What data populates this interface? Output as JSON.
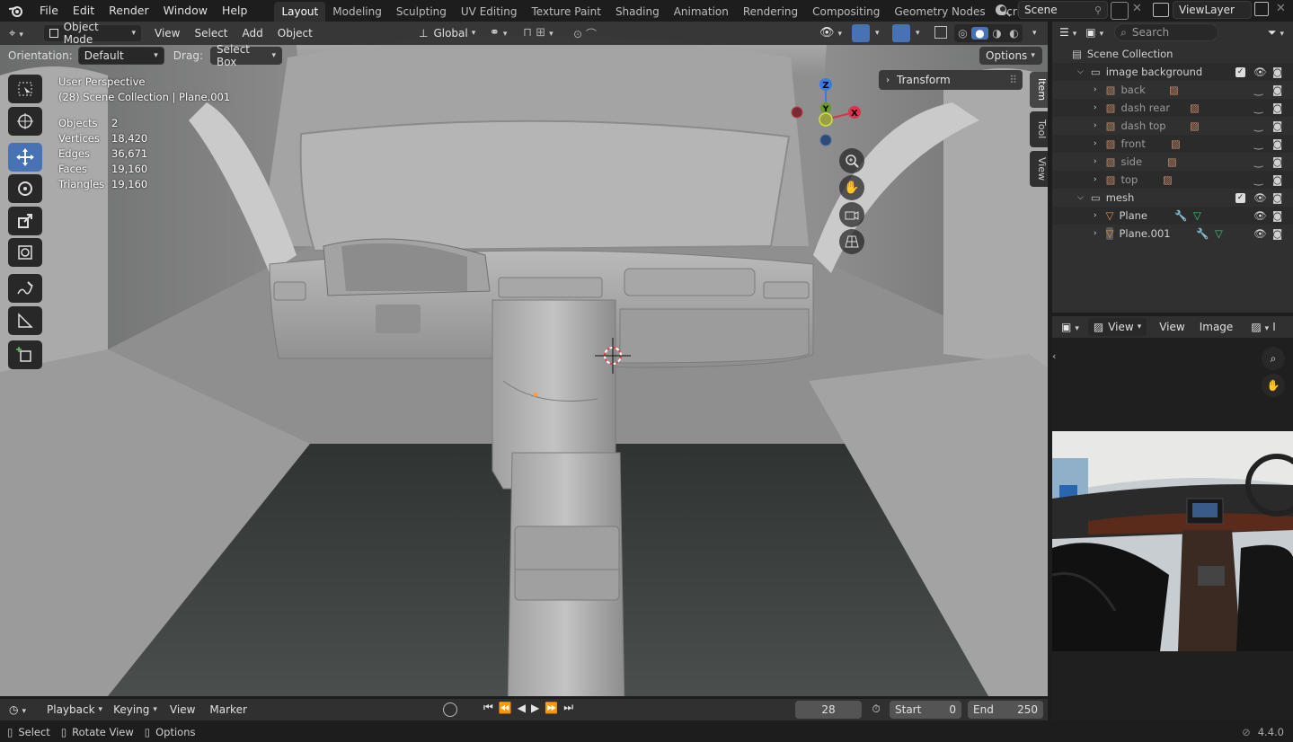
{
  "topbar": {
    "menus": [
      "File",
      "Edit",
      "Render",
      "Window",
      "Help"
    ],
    "workspaces": [
      "Layout",
      "Modeling",
      "Sculpting",
      "UV Editing",
      "Texture Paint",
      "Shading",
      "Animation",
      "Rendering",
      "Compositing",
      "Geometry Nodes",
      "Scripting"
    ],
    "active_workspace": "Layout",
    "scene": "Scene",
    "view_layer": "ViewLayer"
  },
  "viewport": {
    "mode": "Object Mode",
    "menus": [
      "View",
      "Select",
      "Add",
      "Object"
    ],
    "transform_orientation": "Global",
    "orientation_label": "Orientation:",
    "orientation_value": "Default",
    "drag_label": "Drag:",
    "drag_value": "Select Box",
    "options_label": "Options",
    "perspective": "User Perspective",
    "collection_info": "(28) Scene Collection | Plane.001",
    "stats": [
      {
        "label": "Objects",
        "value": "2"
      },
      {
        "label": "Vertices",
        "value": "18,420"
      },
      {
        "label": "Edges",
        "value": "36,671"
      },
      {
        "label": "Faces",
        "value": "19,160"
      },
      {
        "label": "Triangles",
        "value": "19,160"
      }
    ],
    "n_panel_header": "Transform",
    "side_tabs": [
      "Item",
      "Tool",
      "View"
    ],
    "gizmo_axes": {
      "z": "Z",
      "y": "Y",
      "x": "X"
    }
  },
  "timeline": {
    "menus": [
      "Playback",
      "Keying",
      "View",
      "Marker"
    ],
    "current_frame": "28",
    "start_label": "Start",
    "start": "0",
    "end_label": "End",
    "end": "250"
  },
  "status": {
    "items": [
      "Select",
      "Rotate View",
      "Options"
    ],
    "version": "4.4.0"
  },
  "outliner": {
    "search_placeholder": "Search",
    "root": "Scene Collection",
    "collections": [
      {
        "name": "image background",
        "children": [
          "back",
          "dash rear",
          "dash top",
          "front",
          "side",
          "top"
        ]
      },
      {
        "name": "mesh",
        "children": [
          "Plane",
          "Plane.001"
        ]
      }
    ]
  },
  "image_editor": {
    "menus": [
      "View",
      "View",
      "Image"
    ],
    "photo_description_colors": {
      "sky": "#b7c6cf",
      "dash": "#2a2a2a",
      "wood": "#5a2a1a",
      "leather": "#111111"
    }
  },
  "colors": {
    "accent": "#4772b3",
    "x_axis": "#e0304a",
    "y_axis": "#6a9a2c",
    "z_axis": "#3a7be0",
    "selected_orange": "#ffa040"
  }
}
